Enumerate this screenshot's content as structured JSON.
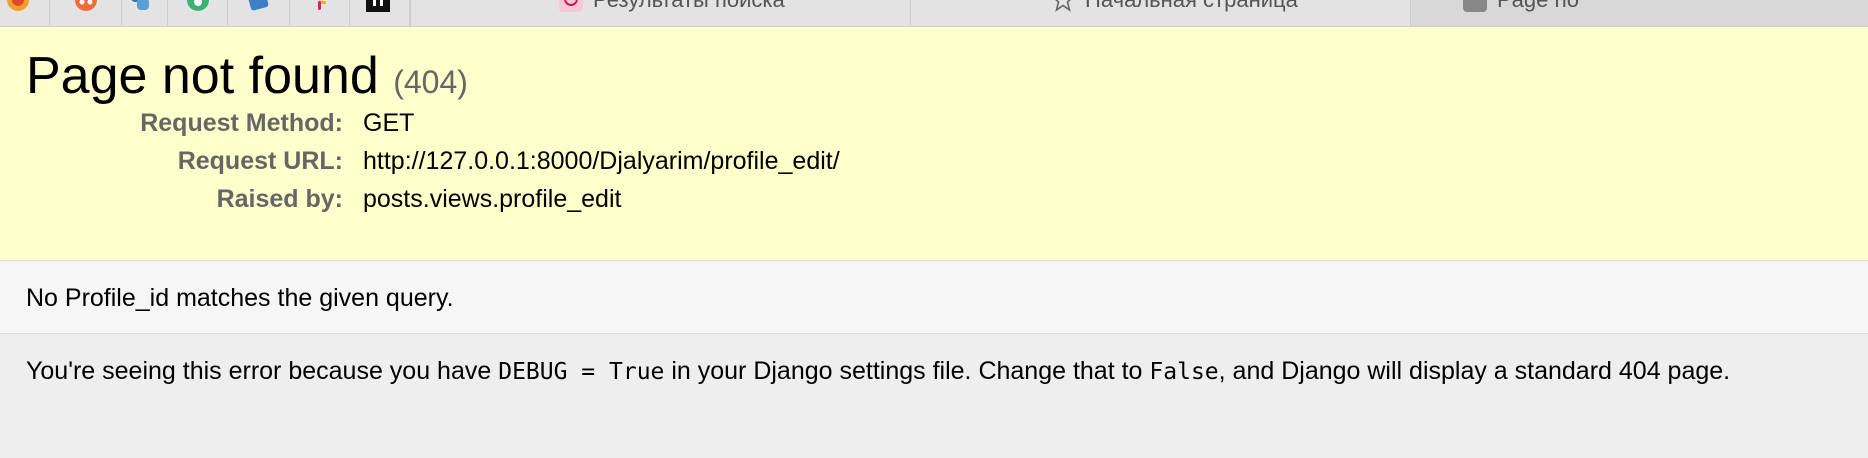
{
  "browser": {
    "tabs": [
      {
        "title": "Результаты поиска",
        "icon": "pinterest-icon"
      },
      {
        "title": "Начальная страница",
        "icon": "star-icon"
      },
      {
        "title": "Page no",
        "icon": "page-icon"
      }
    ]
  },
  "error": {
    "title": "Page not found",
    "status_code": "(404)",
    "meta": [
      {
        "key": "Request Method:",
        "value": "GET"
      },
      {
        "key": "Request URL:",
        "value": "http://127.0.0.1:8000/Djalyarim/profile_edit/"
      },
      {
        "key": "Raised by:",
        "value": "posts.views.profile_edit"
      }
    ],
    "message": "No Profile_id matches the given query.",
    "explanation": {
      "part1": "You're seeing this error because you have ",
      "code1": "DEBUG = True",
      "part2": " in your Django settings file. Change that to ",
      "code2": "False",
      "part3": ", and Django will display a standard 404 page."
    }
  },
  "colors": {
    "summary_bg": "#ffffcc",
    "info_bg": "#f6f6f6",
    "page_bg": "#eeeeee",
    "label": "#666666"
  }
}
